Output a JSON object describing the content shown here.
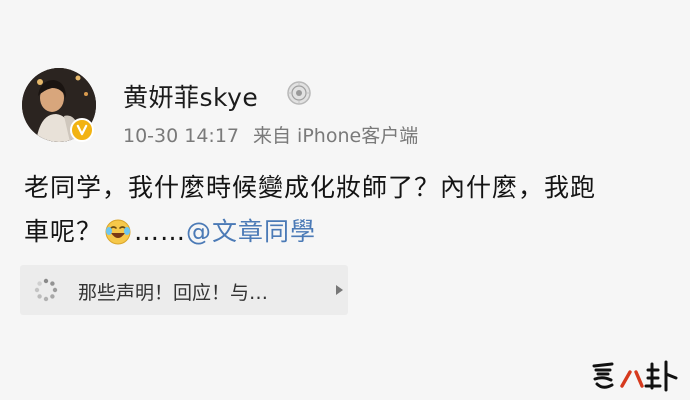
{
  "post": {
    "author": "黄妍菲skye",
    "timestamp": "10-30 14:17",
    "source": "来自 iPhone客户端",
    "content_line1": "老同学，我什麼時候變成化妝師了？內什麼，我跑",
    "content_line2_before_emoji": "車呢？",
    "content_line2_after_emoji": "……",
    "mention": "@文章同學",
    "emoji": "laughing-crying-emoji",
    "accent_color": "#4b7ab6"
  },
  "linked_card": {
    "text": "那些声明！回应！与…",
    "icon": "spinner-icon"
  },
  "watermark": {
    "icon": "ai-ba-gua-logo"
  }
}
